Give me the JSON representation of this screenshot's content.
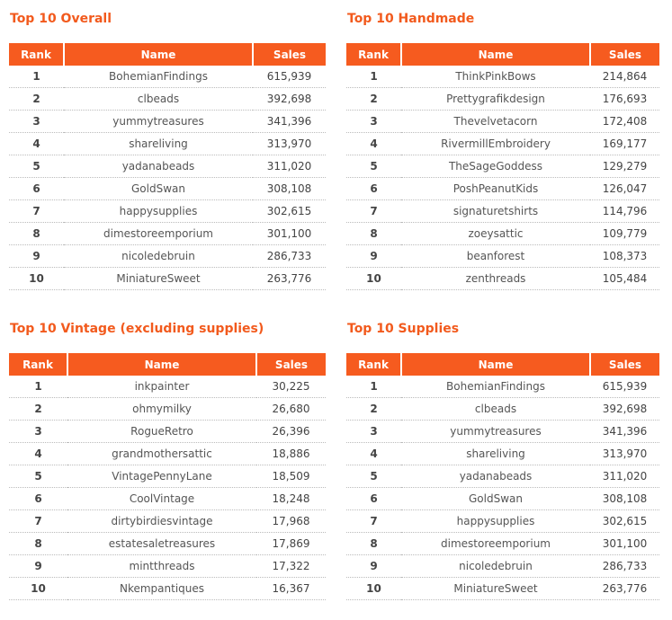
{
  "columns": [
    "Rank",
    "Name",
    "Sales"
  ],
  "tables": [
    {
      "title": "Top 10 Overall",
      "rows": [
        [
          "1",
          "BohemianFindings",
          "615,939"
        ],
        [
          "2",
          "clbeads",
          "392,698"
        ],
        [
          "3",
          "yummytreasures",
          "341,396"
        ],
        [
          "4",
          "shareliving",
          "313,970"
        ],
        [
          "5",
          "yadanabeads",
          "311,020"
        ],
        [
          "6",
          "GoldSwan",
          "308,108"
        ],
        [
          "7",
          "happysupplies",
          "302,615"
        ],
        [
          "8",
          "dimestoreemporium",
          "301,100"
        ],
        [
          "9",
          "nicoledebruin",
          "286,733"
        ],
        [
          "10",
          "MiniatureSweet",
          "263,776"
        ]
      ]
    },
    {
      "title": "Top 10 Handmade",
      "rows": [
        [
          "1",
          "ThinkPinkBows",
          "214,864"
        ],
        [
          "2",
          "Prettygrafikdesign",
          "176,693"
        ],
        [
          "3",
          "Thevelvetacorn",
          "172,408"
        ],
        [
          "4",
          "RivermillEmbroidery",
          "169,177"
        ],
        [
          "5",
          "TheSageGoddess",
          "129,279"
        ],
        [
          "6",
          "PoshPeanutKids",
          "126,047"
        ],
        [
          "7",
          "signaturetshirts",
          "114,796"
        ],
        [
          "8",
          "zoeysattic",
          "109,779"
        ],
        [
          "9",
          "beanforest",
          "108,373"
        ],
        [
          "10",
          "zenthreads",
          "105,484"
        ]
      ]
    },
    {
      "title": "Top 10 Vintage (excluding supplies)",
      "rows": [
        [
          "1",
          "inkpainter",
          "30,225"
        ],
        [
          "2",
          "ohmymilky",
          "26,680"
        ],
        [
          "3",
          "RogueRetro",
          "26,396"
        ],
        [
          "4",
          "grandmothersattic",
          "18,886"
        ],
        [
          "5",
          "VintagePennyLane",
          "18,509"
        ],
        [
          "6",
          "CoolVintage",
          "18,248"
        ],
        [
          "7",
          "dirtybirdiesvintage",
          "17,968"
        ],
        [
          "8",
          "estatesaletreasures",
          "17,869"
        ],
        [
          "9",
          "mintthreads",
          "17,322"
        ],
        [
          "10",
          "Nkempantiques",
          "16,367"
        ]
      ]
    },
    {
      "title": "Top 10 Supplies",
      "rows": [
        [
          "1",
          "BohemianFindings",
          "615,939"
        ],
        [
          "2",
          "clbeads",
          "392,698"
        ],
        [
          "3",
          "yummytreasures",
          "341,396"
        ],
        [
          "4",
          "shareliving",
          "313,970"
        ],
        [
          "5",
          "yadanabeads",
          "311,020"
        ],
        [
          "6",
          "GoldSwan",
          "308,108"
        ],
        [
          "7",
          "happysupplies",
          "302,615"
        ],
        [
          "8",
          "dimestoreemporium",
          "301,100"
        ],
        [
          "9",
          "nicoledebruin",
          "286,733"
        ],
        [
          "10",
          "MiniatureSweet",
          "263,776"
        ]
      ]
    }
  ],
  "colors": {
    "accent": "#f65b1f",
    "title": "#f25a1d"
  }
}
